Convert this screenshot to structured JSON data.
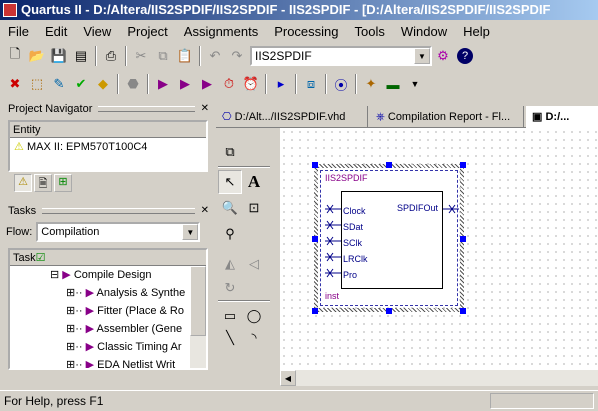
{
  "window": {
    "title": "Quartus II - D:/Altera/IIS2SPDIF/IIS2SPDIF - IIS2SPDIF - [D:/Altera/IIS2SPDIF/IIS2SPDIF"
  },
  "menu": [
    "File",
    "Edit",
    "View",
    "Project",
    "Assignments",
    "Processing",
    "Tools",
    "Window",
    "Help"
  ],
  "toolbar": {
    "project_select": "IIS2SPDIF"
  },
  "project_navigator": {
    "title": "Project Navigator",
    "column": "Entity",
    "entity": "MAX II: EPM570T100C4"
  },
  "tasks": {
    "title": "Tasks",
    "flow_label": "Flow:",
    "flow_value": "Compilation",
    "column": "Task",
    "items": [
      {
        "label": "Compile Design"
      },
      {
        "label": "Analysis & Synthe"
      },
      {
        "label": "Fitter (Place & Ro"
      },
      {
        "label": "Assembler (Gene"
      },
      {
        "label": "Classic Timing Ar"
      },
      {
        "label": "EDA Netlist Writ"
      }
    ]
  },
  "doc_tabs": [
    {
      "label": "D:/Alt.../IIS2SPDIF.vhd"
    },
    {
      "label": "Compilation Report - Fl..."
    },
    {
      "label": "D:/..."
    }
  ],
  "symbol": {
    "name": "IIS2SPDIF",
    "inputs": [
      "Clock",
      "SDat",
      "SClk",
      "LRClk",
      "Pro"
    ],
    "output": "SPDIFOut",
    "instance": "inst"
  },
  "status": {
    "text": "For Help, press F1"
  }
}
